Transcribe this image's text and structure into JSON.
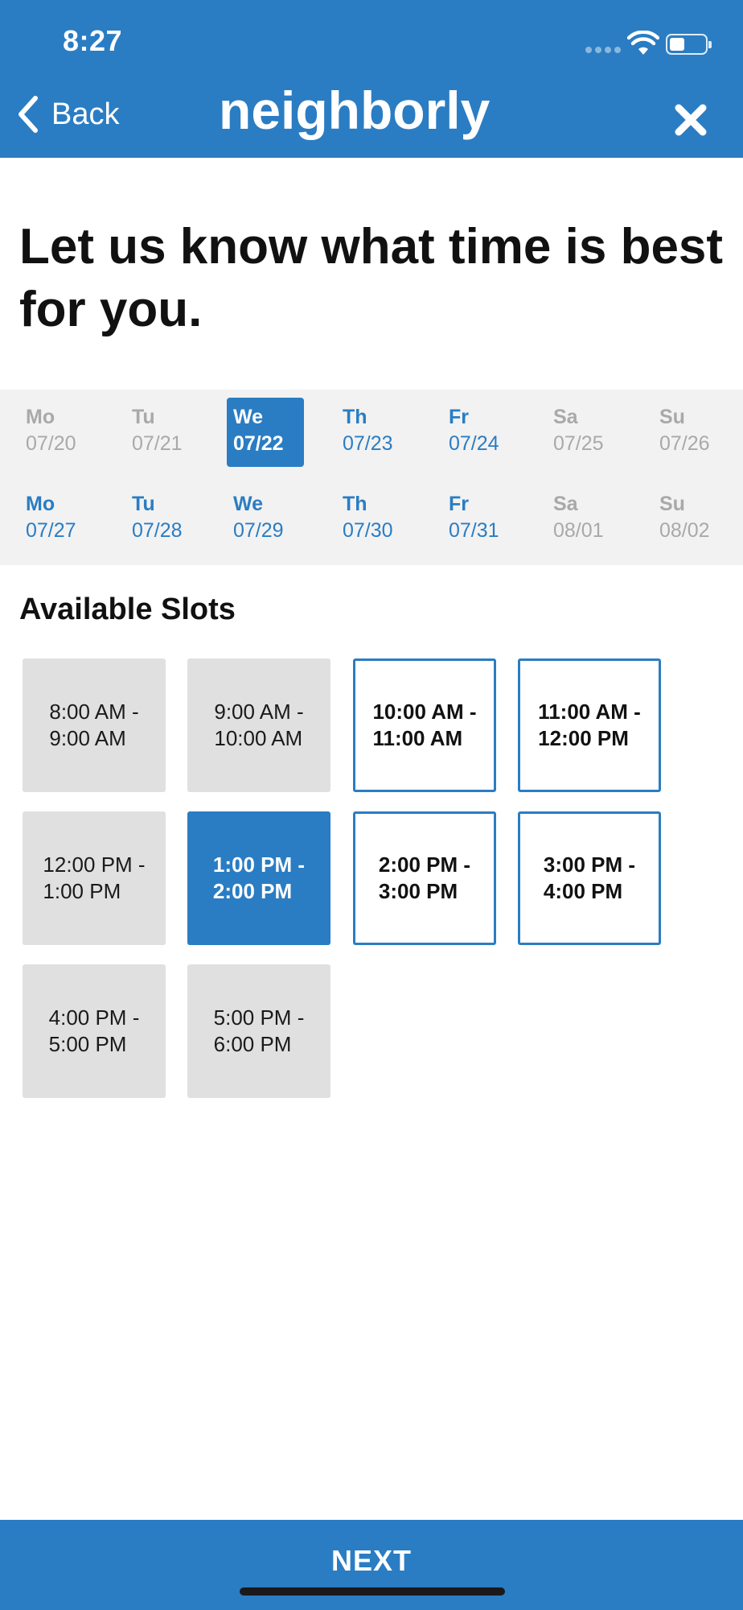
{
  "status_bar": {
    "time": "8:27"
  },
  "header": {
    "back_label": "Back",
    "brand": "neighborly",
    "close_icon": "close-icon",
    "color": "#2a7dc3"
  },
  "headline": "Let us know what time is best for you.",
  "calendar": {
    "days": [
      {
        "name": "Mo",
        "date": "07/20",
        "state": "unavailable"
      },
      {
        "name": "Tu",
        "date": "07/21",
        "state": "unavailable"
      },
      {
        "name": "We",
        "date": "07/22",
        "state": "selected"
      },
      {
        "name": "Th",
        "date": "07/23",
        "state": "available"
      },
      {
        "name": "Fr",
        "date": "07/24",
        "state": "available"
      },
      {
        "name": "Sa",
        "date": "07/25",
        "state": "unavailable"
      },
      {
        "name": "Su",
        "date": "07/26",
        "state": "unavailable"
      },
      {
        "name": "Mo",
        "date": "07/27",
        "state": "available"
      },
      {
        "name": "Tu",
        "date": "07/28",
        "state": "available"
      },
      {
        "name": "We",
        "date": "07/29",
        "state": "available"
      },
      {
        "name": "Th",
        "date": "07/30",
        "state": "available"
      },
      {
        "name": "Fr",
        "date": "07/31",
        "state": "available"
      },
      {
        "name": "Sa",
        "date": "08/01",
        "state": "unavailable"
      },
      {
        "name": "Su",
        "date": "08/02",
        "state": "unavailable"
      }
    ]
  },
  "slots": {
    "title": "Available Slots",
    "items": [
      {
        "label": "8:00 AM -\n9:00 AM",
        "state": "unavailable"
      },
      {
        "label": "9:00 AM -\n10:00 AM",
        "state": "unavailable"
      },
      {
        "label": "10:00 AM -\n11:00 AM",
        "state": "available"
      },
      {
        "label": "11:00 AM -\n12:00 PM",
        "state": "available"
      },
      {
        "label": "12:00 PM -\n1:00 PM",
        "state": "unavailable"
      },
      {
        "label": "1:00 PM -\n2:00 PM",
        "state": "selected"
      },
      {
        "label": "2:00 PM -\n3:00 PM",
        "state": "available"
      },
      {
        "label": "3:00 PM -\n4:00 PM",
        "state": "available"
      },
      {
        "label": "4:00 PM -\n5:00 PM",
        "state": "unavailable"
      },
      {
        "label": "5:00 PM -\n6:00 PM",
        "state": "unavailable"
      }
    ]
  },
  "footer": {
    "next_label": "NEXT"
  }
}
